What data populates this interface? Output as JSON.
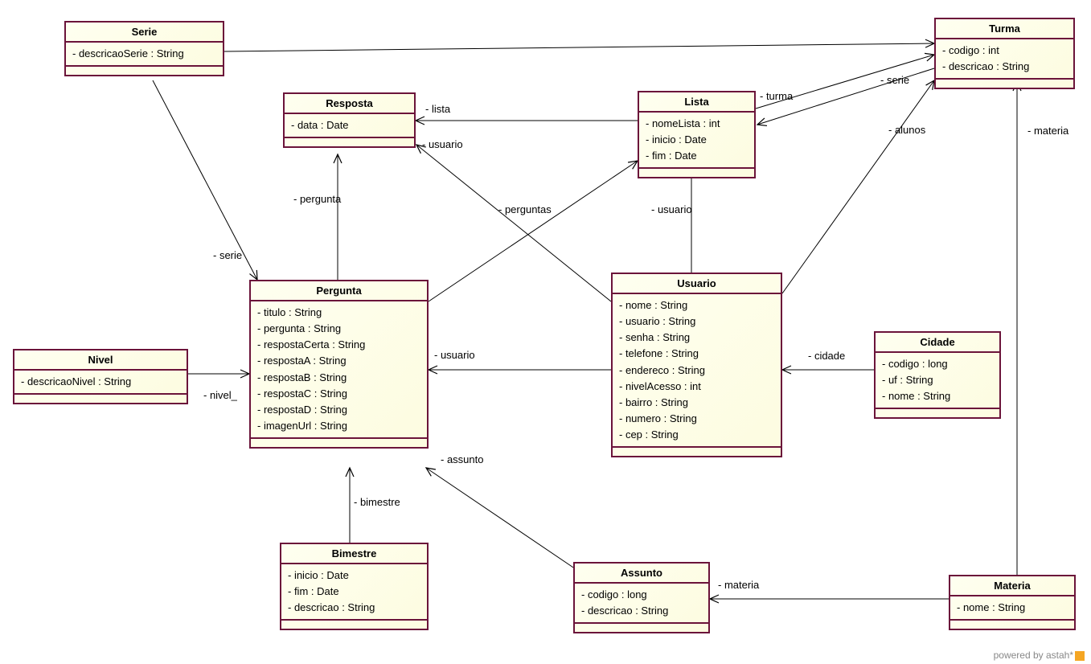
{
  "classes": {
    "serie": {
      "name": "Serie",
      "attrs": [
        "- descricaoSerie : String"
      ]
    },
    "turma": {
      "name": "Turma",
      "attrs": [
        "- codigo : int",
        "- descricao : String"
      ]
    },
    "resposta": {
      "name": "Resposta",
      "attrs": [
        "- data : Date"
      ]
    },
    "lista": {
      "name": "Lista",
      "attrs": [
        "- nomeLista : int",
        "- inicio : Date",
        "- fim : Date"
      ]
    },
    "pergunta": {
      "name": "Pergunta",
      "attrs": [
        "- titulo : String",
        "- pergunta : String",
        "- respostaCerta : String",
        "- respostaA : String",
        "- respostaB : String",
        "- respostaC : String",
        "- respostaD : String",
        "- imagenUrl : String"
      ]
    },
    "usuario": {
      "name": "Usuario",
      "attrs": [
        "- nome : String",
        "- usuario : String",
        "- senha : String",
        "- telefone : String",
        "- endereco : String",
        "- nivelAcesso : int",
        "- bairro : String",
        "- numero : String",
        "- cep : String"
      ]
    },
    "nivel": {
      "name": "Nivel",
      "attrs": [
        "- descricaoNivel : String"
      ]
    },
    "cidade": {
      "name": "Cidade",
      "attrs": [
        "- codigo : long",
        "- uf : String",
        "- nome : String"
      ]
    },
    "bimestre": {
      "name": "Bimestre",
      "attrs": [
        "- inicio : Date",
        "- fim : Date",
        "- descricao : String"
      ]
    },
    "assunto": {
      "name": "Assunto",
      "attrs": [
        "- codigo : long",
        "- descricao : String"
      ]
    },
    "materia": {
      "name": "Materia",
      "attrs": [
        "- nome : String"
      ]
    }
  },
  "labels": {
    "turma_label": "- turma",
    "serie_label2": "- serie",
    "lista_label": "- lista",
    "usuario_label1": "- usuario",
    "pergunta_label": "- pergunta",
    "perguntas_label": "- perguntas",
    "usuario_label2": "- usuario",
    "alunos_label": "- alunos",
    "materia_label2": "- materia",
    "serie_label1": "- serie",
    "usuario_label3": "- usuario",
    "cidade_label": "- cidade",
    "nivel_label": "- nivel_",
    "bimestre_label": "- bimestre",
    "assunto_label": "- assunto",
    "materia_label1": "- materia"
  },
  "footer": "powered by astah*"
}
